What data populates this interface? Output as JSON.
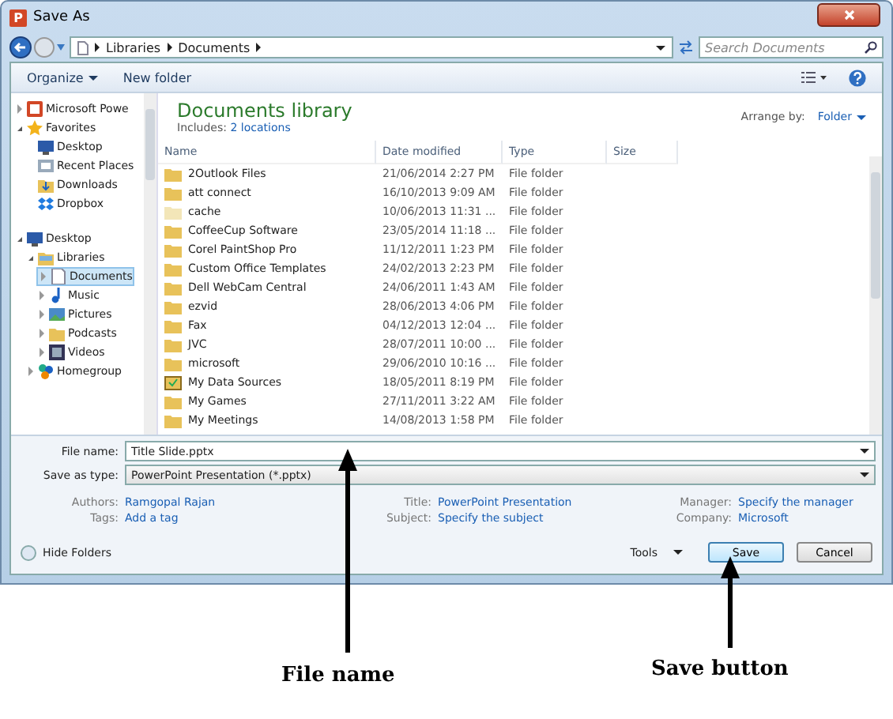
{
  "window": {
    "title": "Save As",
    "app_icon": "P"
  },
  "address": {
    "crumbs": [
      "Libraries",
      "Documents"
    ],
    "search_placeholder": "Search Documents"
  },
  "toolbar": {
    "organize": "Organize",
    "new_folder": "New folder"
  },
  "sidebar": {
    "items": [
      {
        "label": "Microsoft Powe",
        "kind": "app",
        "expanded": false,
        "selected": false
      },
      {
        "label": "Favorites",
        "kind": "star",
        "expanded": true,
        "selected": false,
        "children": [
          {
            "label": "Desktop",
            "kind": "desktop",
            "selected": false
          },
          {
            "label": "Recent Places",
            "kind": "recent",
            "selected": false
          },
          {
            "label": "Downloads",
            "kind": "download",
            "selected": false
          },
          {
            "label": "Dropbox",
            "kind": "dropbox",
            "selected": false
          }
        ]
      },
      {
        "label": "Desktop",
        "kind": "desktop",
        "expanded": true,
        "selected": false,
        "children": [
          {
            "label": "Libraries",
            "kind": "library",
            "expanded": true,
            "selected": false,
            "children": [
              {
                "label": "Documents",
                "kind": "doc",
                "expanded": false,
                "selected": true
              },
              {
                "label": "Music",
                "kind": "music",
                "expanded": false,
                "selected": false
              },
              {
                "label": "Pictures",
                "kind": "pictures",
                "expanded": false,
                "selected": false
              },
              {
                "label": "Podcasts",
                "kind": "folder",
                "expanded": false,
                "selected": false
              },
              {
                "label": "Videos",
                "kind": "video",
                "expanded": false,
                "selected": false
              }
            ]
          },
          {
            "label": "Homegroup",
            "kind": "homegroup",
            "expanded": false,
            "selected": false
          }
        ]
      }
    ]
  },
  "library": {
    "title": "Documents library",
    "includes_label": "Includes:",
    "includes_link": "2 locations",
    "arrange_label": "Arrange by:",
    "arrange_value": "Folder"
  },
  "table": {
    "columns": [
      "Name",
      "Date modified",
      "Type",
      "Size"
    ],
    "rows": [
      {
        "name": "2Outlook Files",
        "date": "21/06/2014 2:27 PM",
        "type": "File folder",
        "kind": "folder"
      },
      {
        "name": "att connect",
        "date": "16/10/2013 9:09 AM",
        "type": "File folder",
        "kind": "folder"
      },
      {
        "name": "cache",
        "date": "10/06/2013 11:31 ...",
        "type": "File folder",
        "kind": "hidden"
      },
      {
        "name": "CoffeeCup Software",
        "date": "23/05/2014 11:18 ...",
        "type": "File folder",
        "kind": "folder"
      },
      {
        "name": "Corel PaintShop Pro",
        "date": "11/12/2011 1:23 PM",
        "type": "File folder",
        "kind": "folder"
      },
      {
        "name": "Custom Office Templates",
        "date": "24/02/2013 2:23 PM",
        "type": "File folder",
        "kind": "folder"
      },
      {
        "name": "Dell WebCam Central",
        "date": "24/06/2011 1:43 AM",
        "type": "File folder",
        "kind": "folder"
      },
      {
        "name": "ezvid",
        "date": "28/06/2013 4:06 PM",
        "type": "File folder",
        "kind": "folder"
      },
      {
        "name": "Fax",
        "date": "04/12/2013 12:04 ...",
        "type": "File folder",
        "kind": "folder"
      },
      {
        "name": "JVC",
        "date": "28/07/2011 10:00 ...",
        "type": "File folder",
        "kind": "folder"
      },
      {
        "name": "microsoft",
        "date": "29/06/2010 10:16 ...",
        "type": "File folder",
        "kind": "folder"
      },
      {
        "name": "My Data Sources",
        "date": "18/05/2011 8:19 PM",
        "type": "File folder",
        "kind": "data"
      },
      {
        "name": "My Games",
        "date": "27/11/2011 3:22 AM",
        "type": "File folder",
        "kind": "folder"
      },
      {
        "name": "My Meetings",
        "date": "14/08/2013 1:58 PM",
        "type": "File folder",
        "kind": "folder"
      }
    ]
  },
  "file_name": {
    "label": "File name:",
    "value": "Title Slide.pptx"
  },
  "save_as_type": {
    "label": "Save as type:",
    "value": "PowerPoint Presentation (*.pptx)"
  },
  "metadata": [
    {
      "label": "Authors:",
      "value": "Ramgopal Rajan"
    },
    {
      "label": "Title:",
      "value": "PowerPoint Presentation"
    },
    {
      "label": "Manager:",
      "value": "Specify the manager"
    },
    {
      "label": "Tags:",
      "value": "Add a tag"
    },
    {
      "label": "Subject:",
      "value": "Specify the subject"
    },
    {
      "label": "Company:",
      "value": "Microsoft"
    }
  ],
  "footer": {
    "hide_folders": "Hide Folders",
    "tools": "Tools",
    "save": "Save",
    "cancel": "Cancel"
  },
  "annotations": [
    {
      "label": "File name"
    },
    {
      "label": "Save button"
    }
  ]
}
